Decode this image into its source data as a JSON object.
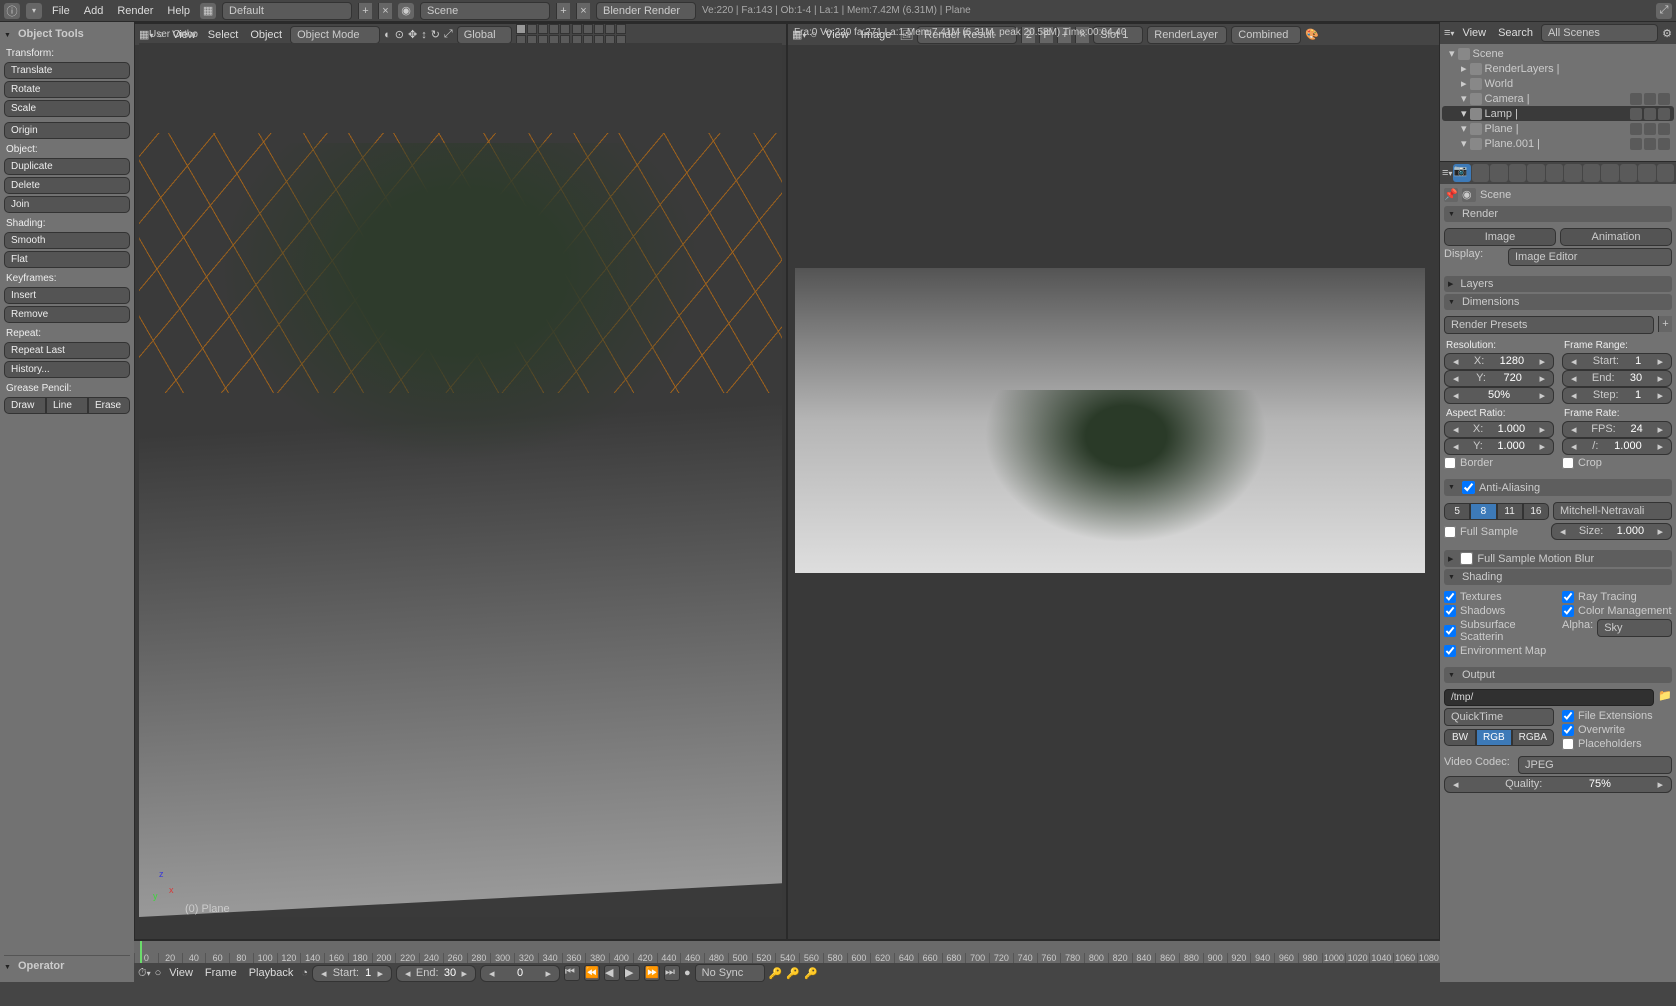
{
  "topbar": {
    "menus": [
      "File",
      "Add",
      "Render",
      "Help"
    ],
    "layout_preset": "Default",
    "scene": "Scene",
    "engine": "Blender Render",
    "stats": "Ve:220 | Fa:143 | Ob:1-4 | La:1 | Mem:7.42M (6.31M) | Plane"
  },
  "toolshelf": {
    "title": "Object Tools",
    "transform_label": "Transform:",
    "translate": "Translate",
    "rotate": "Rotate",
    "scale": "Scale",
    "origin": "Origin",
    "object_label": "Object:",
    "duplicate": "Duplicate",
    "delete": "Delete",
    "join": "Join",
    "shading_label": "Shading:",
    "smooth": "Smooth",
    "flat": "Flat",
    "keyframes_label": "Keyframes:",
    "insert": "Insert",
    "remove": "Remove",
    "repeat_label": "Repeat:",
    "repeat_last": "Repeat Last",
    "history": "History...",
    "grease_label": "Grease Pencil:",
    "draw": "Draw",
    "line": "Line",
    "erase": "Erase",
    "operator_title": "Operator"
  },
  "viewport3d": {
    "header": "User Ortho",
    "object_name": "(0) Plane",
    "menus": [
      "View",
      "Select",
      "Object"
    ],
    "mode": "Object Mode",
    "orientation": "Global"
  },
  "image_editor": {
    "stats": "Fra:0  Ve:220 fa:271 La:1 Mem:7.41M (6.31M, peak 20.58M) Time:00:04.40",
    "menus": [
      "View",
      "Image"
    ],
    "image_name": "Render Result",
    "slot": "Slot 1",
    "layer": "RenderLayer",
    "pass": "Combined",
    "index": "2",
    "f_label": "F"
  },
  "timeline": {
    "ticks": [
      "0",
      "20",
      "40",
      "60",
      "80",
      "100",
      "120",
      "140",
      "160",
      "180",
      "200",
      "220",
      "240",
      "260",
      "280",
      "300",
      "320",
      "340",
      "360",
      "380",
      "400",
      "420",
      "440",
      "460",
      "480",
      "500",
      "520",
      "540",
      "560",
      "580",
      "600",
      "620",
      "640",
      "660",
      "680",
      "700",
      "720",
      "740",
      "760",
      "780",
      "800",
      "820",
      "840",
      "860",
      "880",
      "900",
      "920",
      "940",
      "960",
      "980",
      "1000",
      "1020",
      "1040",
      "1060",
      "1080"
    ],
    "menus": [
      "View",
      "Frame",
      "Playback"
    ],
    "start_label": "Start:",
    "start_val": "1",
    "end_label": "End:",
    "end_val": "30",
    "cur_val": "0",
    "sync": "No Sync"
  },
  "outliner": {
    "view": "View",
    "search": "Search",
    "filter": "All Scenes",
    "items": [
      {
        "name": "Scene",
        "indent": 0,
        "sel": false,
        "exp": true,
        "type": "scene"
      },
      {
        "name": "RenderLayers  |",
        "indent": 1,
        "sel": false,
        "exp": false,
        "type": "layers"
      },
      {
        "name": "World",
        "indent": 1,
        "sel": false,
        "exp": false,
        "type": "world"
      },
      {
        "name": "Camera  |",
        "indent": 1,
        "sel": false,
        "exp": true,
        "type": "camera",
        "tog": true
      },
      {
        "name": "Lamp  |",
        "indent": 1,
        "sel": true,
        "exp": true,
        "type": "lamp",
        "tog": true
      },
      {
        "name": "Plane  |",
        "indent": 1,
        "sel": false,
        "exp": true,
        "type": "mesh",
        "tog": true
      },
      {
        "name": "Plane.001  |",
        "indent": 1,
        "sel": false,
        "exp": true,
        "type": "mesh",
        "tog": true
      }
    ]
  },
  "properties": {
    "breadcrumb": "Scene",
    "render_hdr": "Render",
    "image_btn": "Image",
    "anim_btn": "Animation",
    "display_label": "Display:",
    "display_val": "Image Editor",
    "layers_hdr": "Layers",
    "dims_hdr": "Dimensions",
    "presets": "Render Presets",
    "reso_label": "Resolution:",
    "res_x_lab": "X:",
    "res_x": "1280",
    "res_y_lab": "Y:",
    "res_y": "720",
    "res_pct": "50%",
    "aspect_label": "Aspect Ratio:",
    "asp_x_lab": "X:",
    "asp_x": "1.000",
    "asp_y_lab": "Y:",
    "asp_y": "1.000",
    "frange_label": "Frame Range:",
    "start_lab": "Start:",
    "start": "1",
    "end_lab": "End:",
    "end": "30",
    "step_lab": "Step:",
    "step": "1",
    "frate_label": "Frame Rate:",
    "fps_lab": "FPS:",
    "fps": "24",
    "fpsbase_lab": "/:",
    "fpsbase": "1.000",
    "border": "Border",
    "crop": "Crop",
    "aa_hdr": "Anti-Aliasing",
    "aa_opts": [
      "5",
      "8",
      "11",
      "16"
    ],
    "aa_filter": "Mitchell-Netravali",
    "full_sample": "Full Sample",
    "aa_size_lab": "Size:",
    "aa_size": "1.000",
    "mblur_hdr": "Full Sample Motion Blur",
    "shading_hdr": "Shading",
    "sh_tex": "Textures",
    "sh_ray": "Ray Tracing",
    "sh_shad": "Shadows",
    "sh_cm": "Color Management",
    "sh_sss": "Subsurface Scatterin",
    "sh_alpha_lab": "Alpha:",
    "sh_alpha": "Sky",
    "sh_env": "Environment Map",
    "output_hdr": "Output",
    "output_path": "/tmp/",
    "container": "QuickTime",
    "file_ext": "File Extensions",
    "color_modes": [
      "BW",
      "RGB",
      "RGBA"
    ],
    "overwrite": "Overwrite",
    "placeholders": "Placeholders",
    "vcodec_lab": "Video Codec:",
    "vcodec": "JPEG",
    "quality_lab": "Quality:",
    "quality": "75%"
  }
}
